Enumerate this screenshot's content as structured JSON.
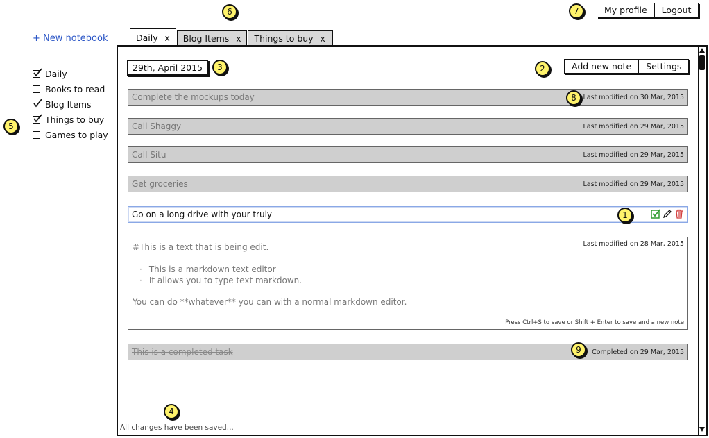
{
  "sidebar": {
    "new_notebook": "+ New notebook",
    "notebooks": [
      {
        "label": "Daily",
        "checked": true
      },
      {
        "label": "Books to read",
        "checked": false
      },
      {
        "label": "Blog Items",
        "checked": true
      },
      {
        "label": "Things to buy",
        "checked": true
      },
      {
        "label": "Games to play",
        "checked": false
      }
    ]
  },
  "header": {
    "my_profile": "My profile",
    "logout": "Logout"
  },
  "tabs": [
    {
      "label": "Daily",
      "close": "x"
    },
    {
      "label": "Blog Items",
      "close": "x"
    },
    {
      "label": "Things to buy",
      "close": "x"
    }
  ],
  "main": {
    "date": "29th, April 2015",
    "add_note": "Add new note",
    "settings": "Settings",
    "notes": [
      {
        "title": "Complete the mockups today",
        "meta": "Last modified on 30 Mar, 2015"
      },
      {
        "title": "Call Shaggy",
        "meta": "Last modified on 29 Mar, 2015"
      },
      {
        "title": "Call Situ",
        "meta": "Last modified on 29 Mar, 2015"
      },
      {
        "title": "Get groceries",
        "meta": "Last modified on 29 Mar, 2015"
      }
    ],
    "selected_note": {
      "title": "Go on a long drive with your truly"
    },
    "editor": {
      "heading": "#This is a text that is being edit.",
      "meta": "Last modified on 28 Mar, 2015",
      "bullets": [
        "This is a markdown text editor",
        "It allows you to type text markdown."
      ],
      "paragraph": "You can do **whatever** you can with a normal markdown editor.",
      "hint": "Press Ctrl+S to save or Shift + Enter to save and a new note"
    },
    "completed_note": {
      "title": "This is a completed task",
      "meta": "Completed on 29 Mar, 2015"
    },
    "status": "All changes have been saved..."
  },
  "callouts": [
    "1",
    "2",
    "3",
    "4",
    "5",
    "6",
    "7",
    "8",
    "9"
  ],
  "colors": {
    "callout": "#fff36b",
    "link": "#2a55c6",
    "check": "#2e9b2e",
    "delete": "#d23a3a"
  }
}
